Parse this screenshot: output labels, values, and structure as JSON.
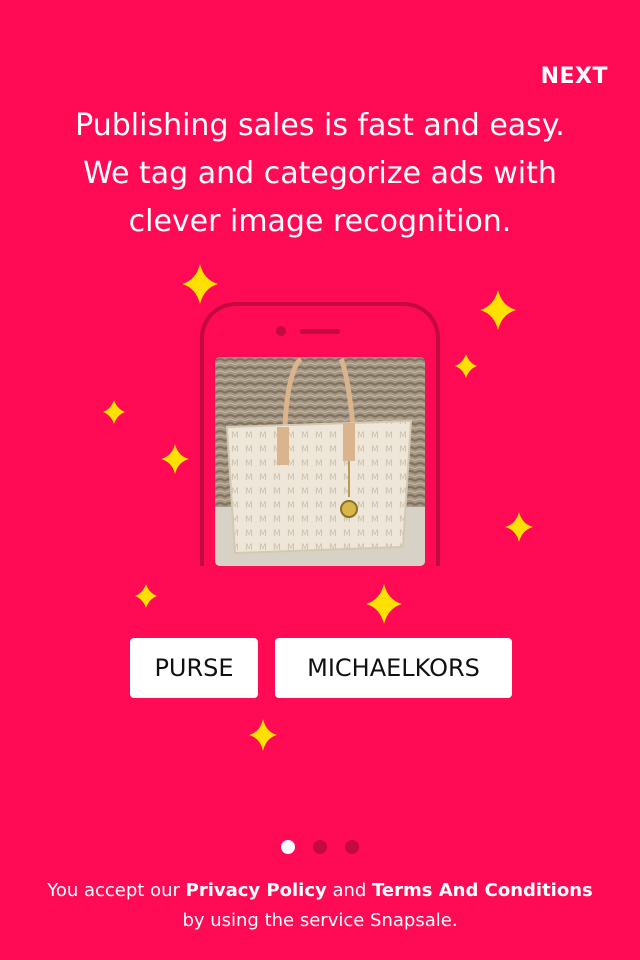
{
  "header": {
    "next_label": "NEXT"
  },
  "headline": {
    "line1": "Publishing sales is fast and easy.",
    "line2": "We tag and categorize ads with",
    "line3": "clever image recognition."
  },
  "tags": [
    "PURSE",
    "MICHAELKORS"
  ],
  "pager": {
    "count": 3,
    "active": 1
  },
  "footer": {
    "prefix": "You accept our ",
    "privacy_label": "Privacy Policy",
    "and": " and ",
    "terms_label": "Terms And Conditions",
    "suffix": "by using the service Snapsale."
  },
  "colors": {
    "background": "#fe0a55",
    "phone_outline": "#c3093f",
    "sparkle": "#ffe000",
    "tag_bg": "#ffffff",
    "dot_active": "#ffffff",
    "dot_inactive": "#c3093f"
  }
}
